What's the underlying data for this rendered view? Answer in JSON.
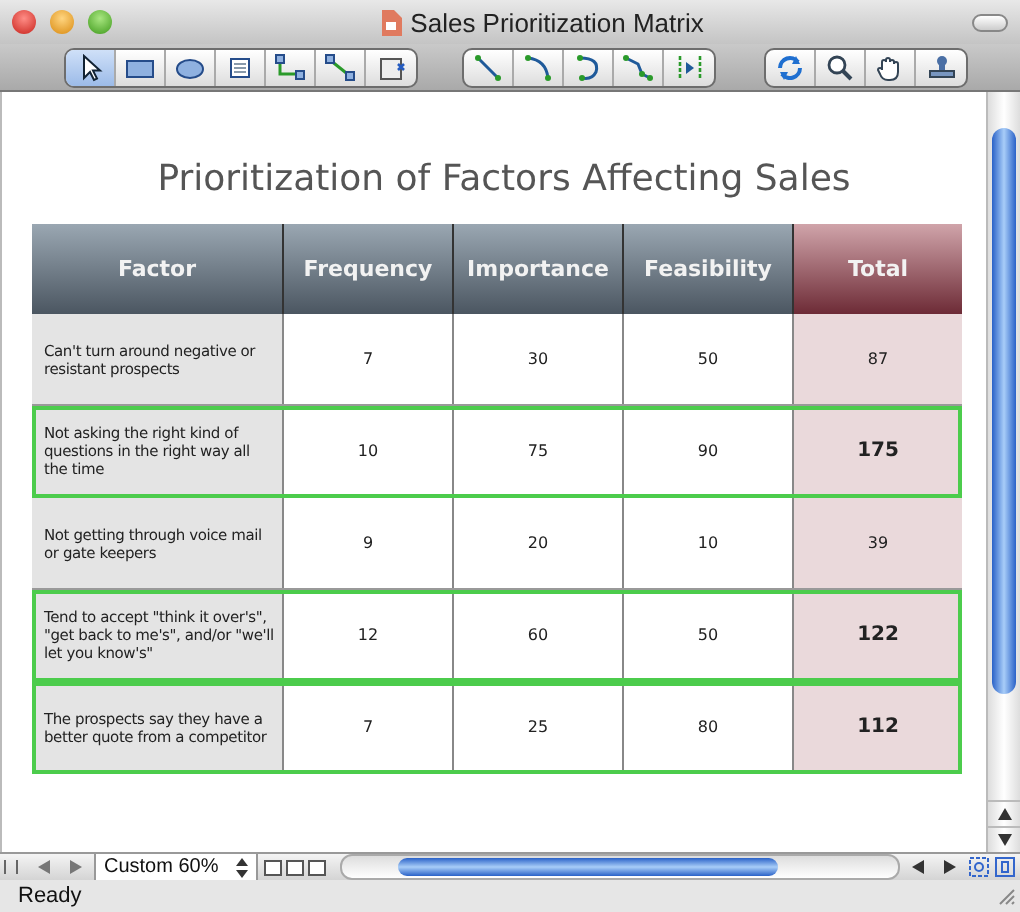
{
  "window": {
    "title": "Sales Prioritization Matrix"
  },
  "toolbar": [
    [
      {
        "kind": "pointer",
        "selected": true
      },
      {
        "kind": "rectangle",
        "selected": false
      },
      {
        "kind": "ellipse",
        "selected": false
      },
      {
        "kind": "frame",
        "selected": false
      },
      {
        "kind": "elbow",
        "selected": false
      },
      {
        "kind": "connector",
        "selected": false
      },
      {
        "kind": "insert",
        "selected": false
      }
    ],
    [
      {
        "kind": "line",
        "selected": false
      },
      {
        "kind": "arc",
        "selected": false
      },
      {
        "kind": "curve",
        "selected": false
      },
      {
        "kind": "polyline",
        "selected": false
      },
      {
        "kind": "split",
        "selected": false
      }
    ],
    [
      {
        "kind": "rotate",
        "selected": false
      },
      {
        "kind": "zoom",
        "selected": false
      },
      {
        "kind": "hand",
        "selected": false
      },
      {
        "kind": "stamp",
        "selected": false
      }
    ]
  ],
  "heading": "Prioritization of Factors Affecting Sales",
  "table": {
    "columns": [
      "Factor",
      "Frequency",
      "Importance",
      "Feasibility",
      "Total"
    ],
    "rows": [
      {
        "factor": "Can't turn around negative or resistant prospects",
        "frequency": "7",
        "importance": "30",
        "feasibility": "50",
        "total": "87",
        "highlighted": false
      },
      {
        "factor": "Not asking the right kind of questions in the right way all the time",
        "frequency": "10",
        "importance": "75",
        "feasibility": "90",
        "total": "175",
        "highlighted": true
      },
      {
        "factor": "Not getting through voice mail or gate keepers",
        "frequency": "9",
        "importance": "20",
        "feasibility": "10",
        "total": "39",
        "highlighted": false
      },
      {
        "factor": "Tend to accept \"think it over's\", \"get back to me's\", and/or \"we'll let you know's\"",
        "frequency": "12",
        "importance": "60",
        "feasibility": "50",
        "total": "122",
        "highlighted": true
      },
      {
        "factor": "The prospects say they have a better quote from a competitor",
        "frequency": "7",
        "importance": "25",
        "feasibility": "80",
        "total": "112",
        "highlighted": true
      }
    ]
  },
  "zoom": "Custom 60%",
  "status_bar": "Ready"
}
